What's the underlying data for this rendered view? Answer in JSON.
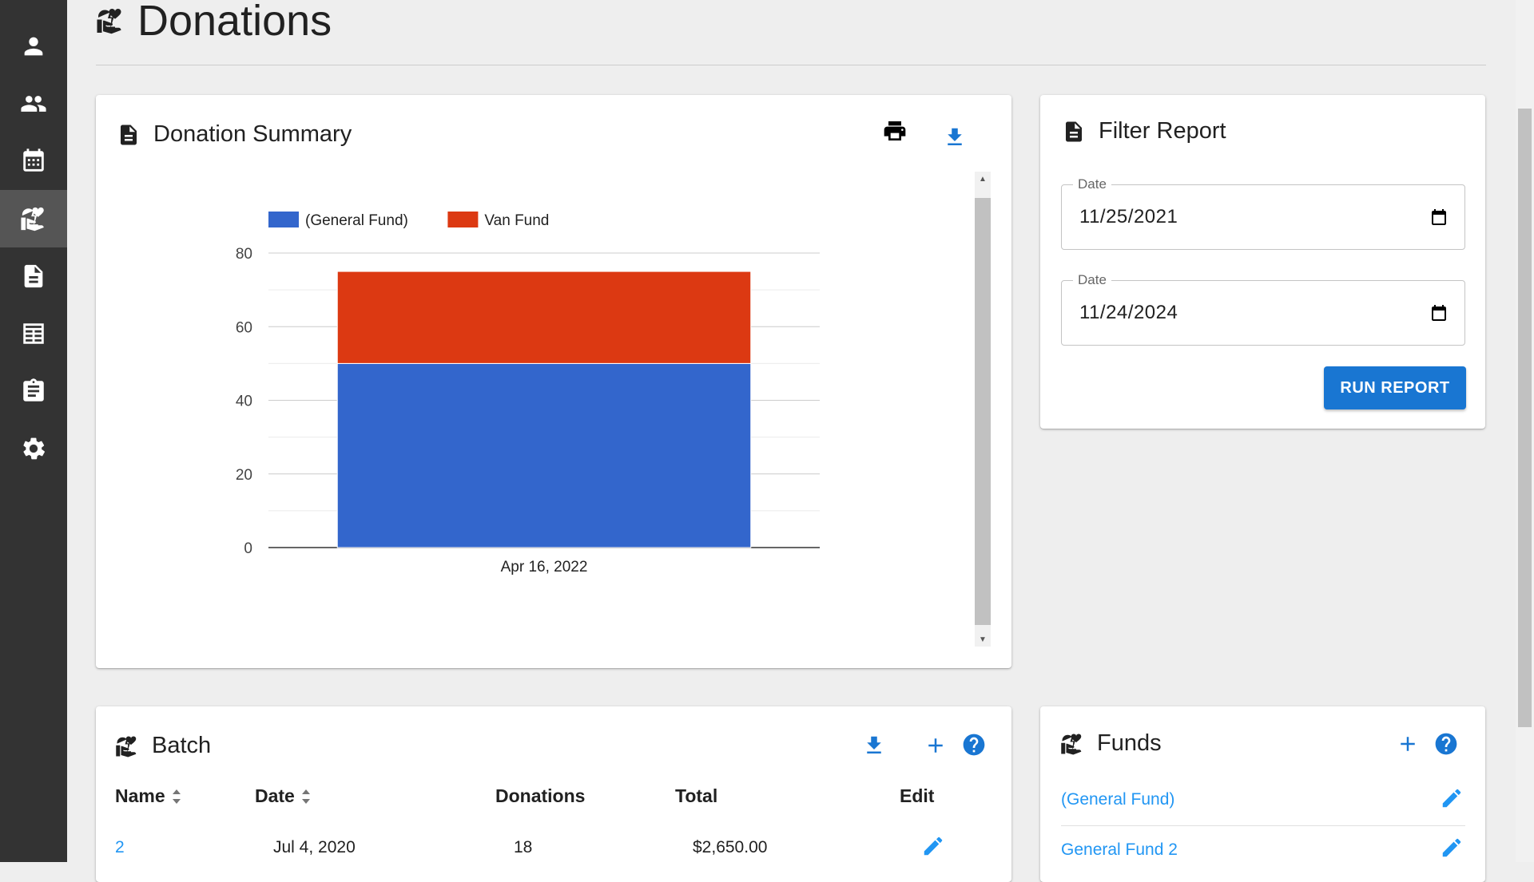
{
  "sidebar": {
    "items": [
      {
        "icon": "person-icon",
        "label": ""
      },
      {
        "icon": "people-icon",
        "label": ""
      },
      {
        "icon": "calendar-icon",
        "label": ""
      },
      {
        "icon": "donations-icon",
        "label": "",
        "active": true
      },
      {
        "icon": "document-icon",
        "label": ""
      },
      {
        "icon": "table-icon",
        "label": ""
      },
      {
        "icon": "clipboard-icon",
        "label": ""
      },
      {
        "icon": "gear-icon",
        "label": ""
      }
    ]
  },
  "page": {
    "title": "Donations",
    "icon": "donations-icon"
  },
  "summary_card": {
    "title": "Donation Summary",
    "icon": "document-icon",
    "actions": [
      "print-icon",
      "download-icon"
    ]
  },
  "chart_data": {
    "type": "bar",
    "stacked": true,
    "categories": [
      "Apr 16, 2022"
    ],
    "series": [
      {
        "name": "(General Fund)",
        "values": [
          50
        ],
        "color": "#3366cc"
      },
      {
        "name": "Van Fund",
        "values": [
          25
        ],
        "color": "#dc3912"
      }
    ],
    "yticks": [
      "0",
      "20",
      "40",
      "60",
      "80"
    ],
    "ylim": [
      0,
      80
    ],
    "legend_position": "top",
    "grid": true,
    "title": "",
    "xlabel": "",
    "ylabel": ""
  },
  "filter": {
    "title": "Filter Report",
    "icon": "document-icon",
    "start_label": "Date",
    "start_value": "11/25/2021",
    "end_label": "Date",
    "end_value": "11/24/2024",
    "button": "RUN REPORT"
  },
  "batch": {
    "title": "Batch",
    "icon": "donations-icon",
    "columns": [
      "Name",
      "Date",
      "Donations",
      "Total",
      "Edit"
    ],
    "rows": [
      {
        "name": "2",
        "date": "Jul 4, 2020",
        "donations": "18",
        "total": "$2,650.00"
      }
    ]
  },
  "funds": {
    "title": "Funds",
    "icon": "donations-icon",
    "items": [
      "(General Fund)",
      "General Fund 2"
    ]
  },
  "colors": {
    "accent": "#1976d2",
    "link": "#2196f3",
    "sidebar": "#333333"
  }
}
